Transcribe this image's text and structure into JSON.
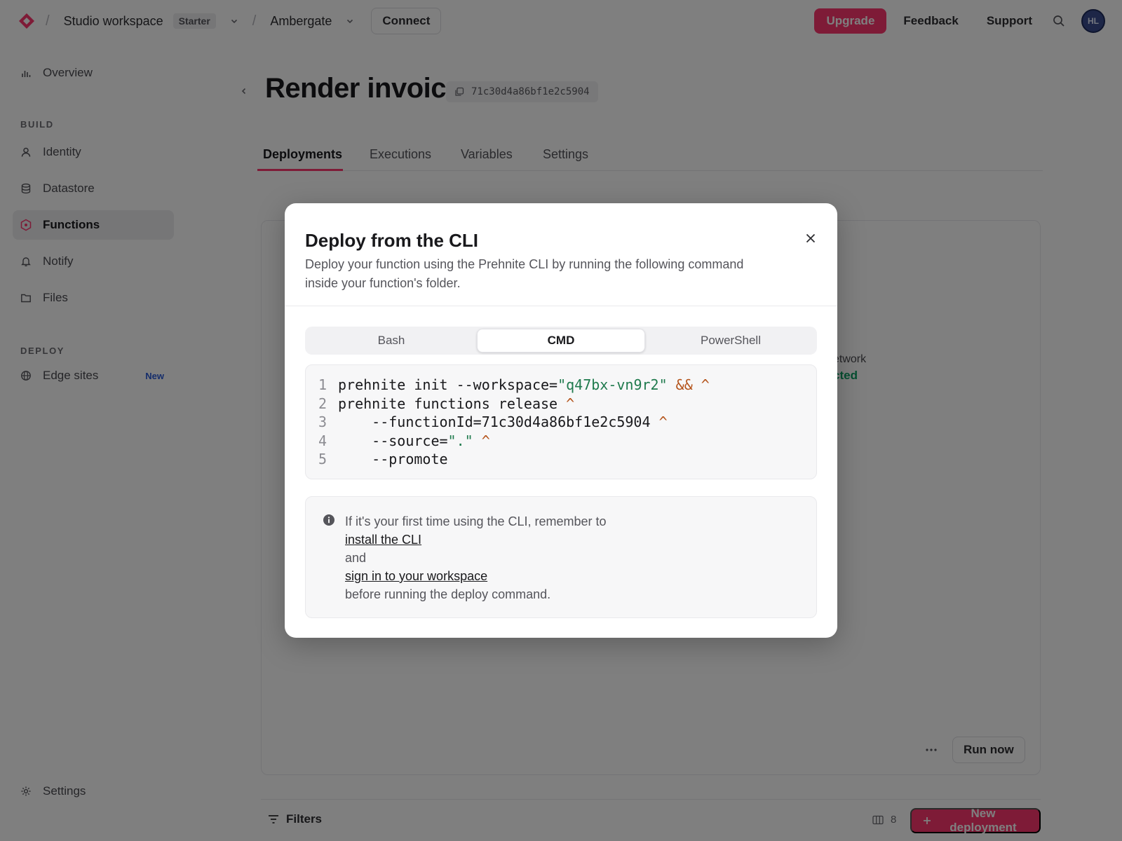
{
  "topbar": {
    "workspace": "Studio workspace",
    "plan": "Starter",
    "project": "Ambergate",
    "connect_label": "Connect",
    "upgrade_label": "Upgrade",
    "feedback_label": "Feedback",
    "support_label": "Support",
    "avatar_initials": "HL"
  },
  "sidebar": {
    "overview": "Overview",
    "build_section": "BUILD",
    "build_items": [
      "Identity",
      "Datastore",
      "Functions",
      "Notify",
      "Files"
    ],
    "active_item": "Functions",
    "deploy_section": "DEPLOY",
    "edge_sites": "Edge sites",
    "edge_badge": "New",
    "settings": "Settings"
  },
  "page": {
    "title": "Render invoice",
    "function_id": "71c30d4a86bf1e2c5904",
    "tabs": [
      "Deployments",
      "Executions",
      "Variables",
      "Settings"
    ],
    "active_tab": "Deployments",
    "ghost_network": "etwork",
    "ghost_status": "cted",
    "run_now_label": "Run now",
    "filters_label": "Filters",
    "columns_count": "8",
    "new_deployment_label": "New deployment"
  },
  "modal": {
    "title": "Deploy from the CLI",
    "description_line1": "Deploy your function using the Prehnite CLI by running the following command",
    "description_line2": "inside your function's folder.",
    "shell_tabs": [
      "Bash",
      "CMD",
      "PowerShell"
    ],
    "active_shell": "CMD",
    "code": {
      "line_numbers": [
        "1",
        "2",
        "3",
        "4",
        "5"
      ],
      "l1_cmd": "prehnite init --workspace=",
      "l1_str": "\"q47bx-vn9r2\"",
      "l1_op": " && ^",
      "l2_cmd": "prehnite functions release",
      "l2_op": " ^",
      "l3_cmd": "    --functionId=71c30d4a86bf1e2c5904",
      "l3_op": " ^",
      "l4_cmd": "    --source=",
      "l4_str": "\".\"",
      "l4_op": " ^",
      "l5_cmd": "    --promote"
    },
    "info": {
      "line1": "If it's your first time using the CLI, remember to",
      "link1": "install the CLI",
      "line2": "and",
      "link2": "sign in to your workspace",
      "line3": "before running the deploy command."
    }
  },
  "colors": {
    "accent": "#fd366e",
    "success": "#0a9e63",
    "code_string": "#1f7a4d",
    "code_operator": "#b4531a"
  }
}
